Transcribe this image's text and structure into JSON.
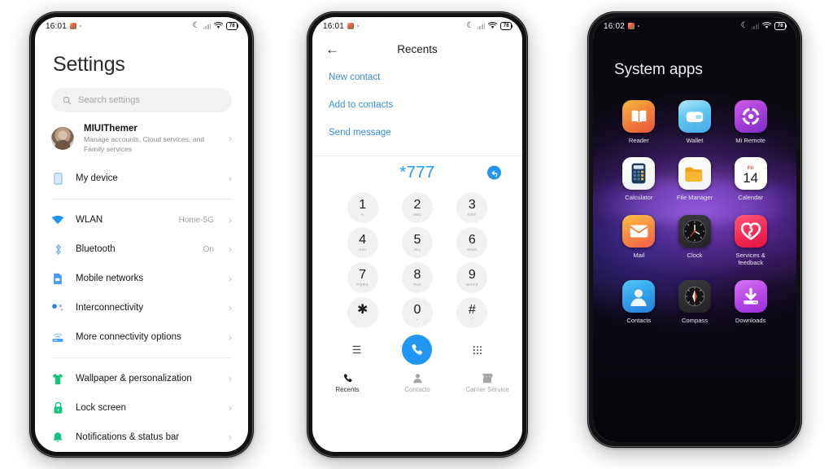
{
  "status_bar": {
    "time_left": "16:01",
    "time_right": "16:02",
    "battery": "78",
    "moon_icon": "do-not-disturb-moon-icon",
    "wifi_icon": "wifi-icon",
    "signal_icon": "cellular-signal-icon"
  },
  "settings": {
    "title": "Settings",
    "search": {
      "placeholder": "Search settings",
      "icon": "search-icon"
    },
    "account": {
      "name": "MIUIThemer",
      "subtitle": "Manage accounts, Cloud services, and Family services",
      "avatar": "user-avatar"
    },
    "groups": [
      {
        "items": [
          {
            "label": "My device",
            "value": "",
            "icon": "phone-device-icon",
            "color": "#8ab7f5"
          }
        ]
      },
      {
        "items": [
          {
            "label": "WLAN",
            "value": "Home-5G",
            "icon": "wifi-icon",
            "color": "#2196f3"
          },
          {
            "label": "Bluetooth",
            "value": "On",
            "icon": "bluetooth-icon",
            "color": "#7fb6f2"
          },
          {
            "label": "Mobile networks",
            "value": "",
            "icon": "sim-card-icon",
            "color": "#4a9ef0"
          },
          {
            "label": "Interconnectivity",
            "value": "",
            "icon": "interconnect-dots-icon",
            "color": "#2a7fe0"
          },
          {
            "label": "More connectivity options",
            "value": "",
            "icon": "router-icon",
            "color": "#5aa6f0"
          }
        ]
      },
      {
        "items": [
          {
            "label": "Wallpaper & personalization",
            "value": "",
            "icon": "tshirt-icon",
            "color": "#17c47f"
          },
          {
            "label": "Lock screen",
            "value": "",
            "icon": "lock-icon",
            "color": "#17c47f"
          },
          {
            "label": "Notifications & status bar",
            "value": "",
            "icon": "bell-icon",
            "color": "#17c47f"
          }
        ]
      }
    ],
    "chevron": "›"
  },
  "dialer": {
    "title": "Recents",
    "back_icon": "back-arrow-icon",
    "actions": [
      {
        "label": "New contact"
      },
      {
        "label": "Add to contacts"
      },
      {
        "label": "Send message"
      }
    ],
    "entered_number": "*777",
    "backspace_icon": "undo-backspace-icon",
    "keys": [
      {
        "digit": "1",
        "sub": "∞"
      },
      {
        "digit": "2",
        "sub": "ABC"
      },
      {
        "digit": "3",
        "sub": "DEF"
      },
      {
        "digit": "4",
        "sub": "GHI"
      },
      {
        "digit": "5",
        "sub": "JKL"
      },
      {
        "digit": "6",
        "sub": "MNO"
      },
      {
        "digit": "7",
        "sub": "PQRS"
      },
      {
        "digit": "8",
        "sub": "TUV"
      },
      {
        "digit": "9",
        "sub": "WXYZ"
      },
      {
        "digit": "✱",
        "sub": ","
      },
      {
        "digit": "0",
        "sub": "+"
      },
      {
        "digit": "#",
        "sub": ";"
      }
    ],
    "tools": {
      "left_icon": "menu-lines-icon",
      "call_icon": "call-phone-icon",
      "right_icon": "keypad-dots-icon"
    },
    "bottom_nav": [
      {
        "label": "Recents",
        "icon": "phone-handset-icon",
        "active": true
      },
      {
        "label": "Contacts",
        "icon": "person-icon",
        "active": false
      },
      {
        "label": "Carrier Service",
        "icon": "store-icon",
        "active": false
      }
    ]
  },
  "home": {
    "title": "System apps",
    "apps": [
      {
        "name": "Reader",
        "icon": "book-reader-icon"
      },
      {
        "name": "Wallet",
        "icon": "wallet-icon"
      },
      {
        "name": "Mi Remote",
        "icon": "remote-control-icon"
      },
      {
        "name": "Calculator",
        "icon": "calculator-icon"
      },
      {
        "name": "File Manager",
        "icon": "folder-icon"
      },
      {
        "name": "Calendar",
        "icon": "calendar-icon",
        "day_label": "Fri",
        "day_number": "14"
      },
      {
        "name": "Mail",
        "icon": "envelope-icon"
      },
      {
        "name": "Clock",
        "icon": "analog-clock-icon"
      },
      {
        "name": "Services & feedback",
        "icon": "heart-feedback-icon"
      },
      {
        "name": "Contacts",
        "icon": "contacts-person-icon"
      },
      {
        "name": "Compass",
        "icon": "compass-icon"
      },
      {
        "name": "Downloads",
        "icon": "download-arrow-icon"
      }
    ]
  },
  "colors": {
    "accent_blue": "#2196f3",
    "link_blue": "#3a8ede",
    "green": "#17c47f",
    "page_bg": "#ffffff"
  }
}
